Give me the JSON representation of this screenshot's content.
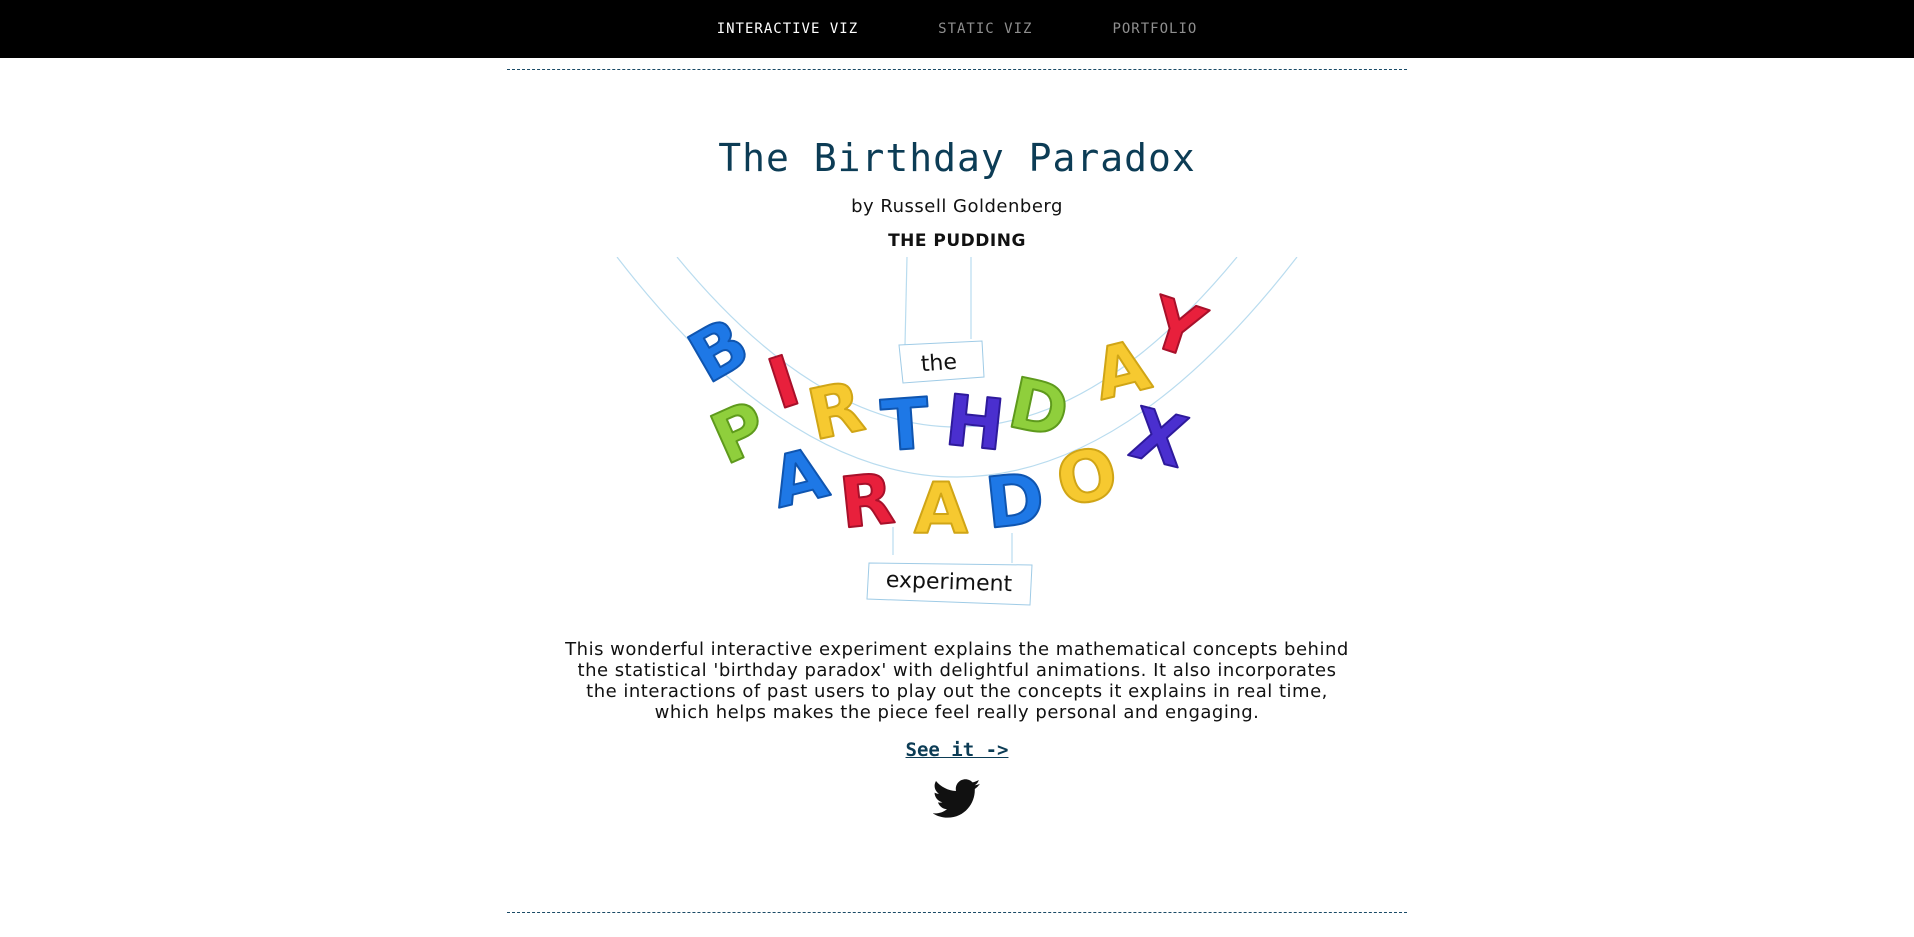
{
  "nav": {
    "items": [
      {
        "label": "INTERACTIVE VIZ",
        "active": true
      },
      {
        "label": "STATIC VIZ",
        "active": false
      },
      {
        "label": "PORTFOLIO",
        "active": false
      }
    ]
  },
  "article": {
    "title": "The Birthday Paradox",
    "byline": "by Russell Goldenberg",
    "publisher": "THE PUDDING",
    "artwork": {
      "label_top": "the",
      "word_one": "BIRTHDAY",
      "word_two": "PARADOX",
      "label_bottom": "experiment"
    },
    "description": "This wonderful interactive experiment explains the mathematical concepts behind the statistical 'birthday paradox' with delightful animations. It also incorporates the interactions of past users to play out the concepts it explains in real time, which helps makes the piece feel really personal and engaging.",
    "link_label": "See it ->",
    "share_icon": "twitter-icon"
  },
  "colors": {
    "nav_bg": "#000000",
    "title": "#0c3c55",
    "link": "#0c3c55",
    "rule": "#1a4a66",
    "letters": [
      "#1e78e6",
      "#e8203c",
      "#f6c930",
      "#8fcf3c",
      "#4a2fcf"
    ]
  }
}
